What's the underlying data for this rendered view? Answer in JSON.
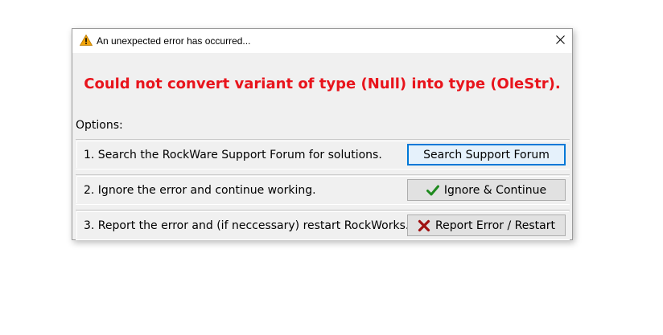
{
  "dialog": {
    "title": "An unexpected error has occurred...",
    "title_icon": "warning-icon",
    "close_icon": "close-icon",
    "error_message": "Could not convert variant of type (Null) into type (OleStr).",
    "error_color": "#e8141c",
    "options_label": "Options:",
    "options": [
      {
        "text": "1. Search the RockWare Support Forum for solutions.",
        "button_label": "Search Support Forum",
        "button_icon": ""
      },
      {
        "text": "2. Ignore the error and continue working.",
        "button_label": "Ignore & Continue",
        "button_icon": "checkmark-icon"
      },
      {
        "text": "3. Report the error and (if neccessary) restart RockWorks.",
        "button_label": "Report Error / Restart",
        "button_icon": "x-mark-icon"
      }
    ]
  }
}
